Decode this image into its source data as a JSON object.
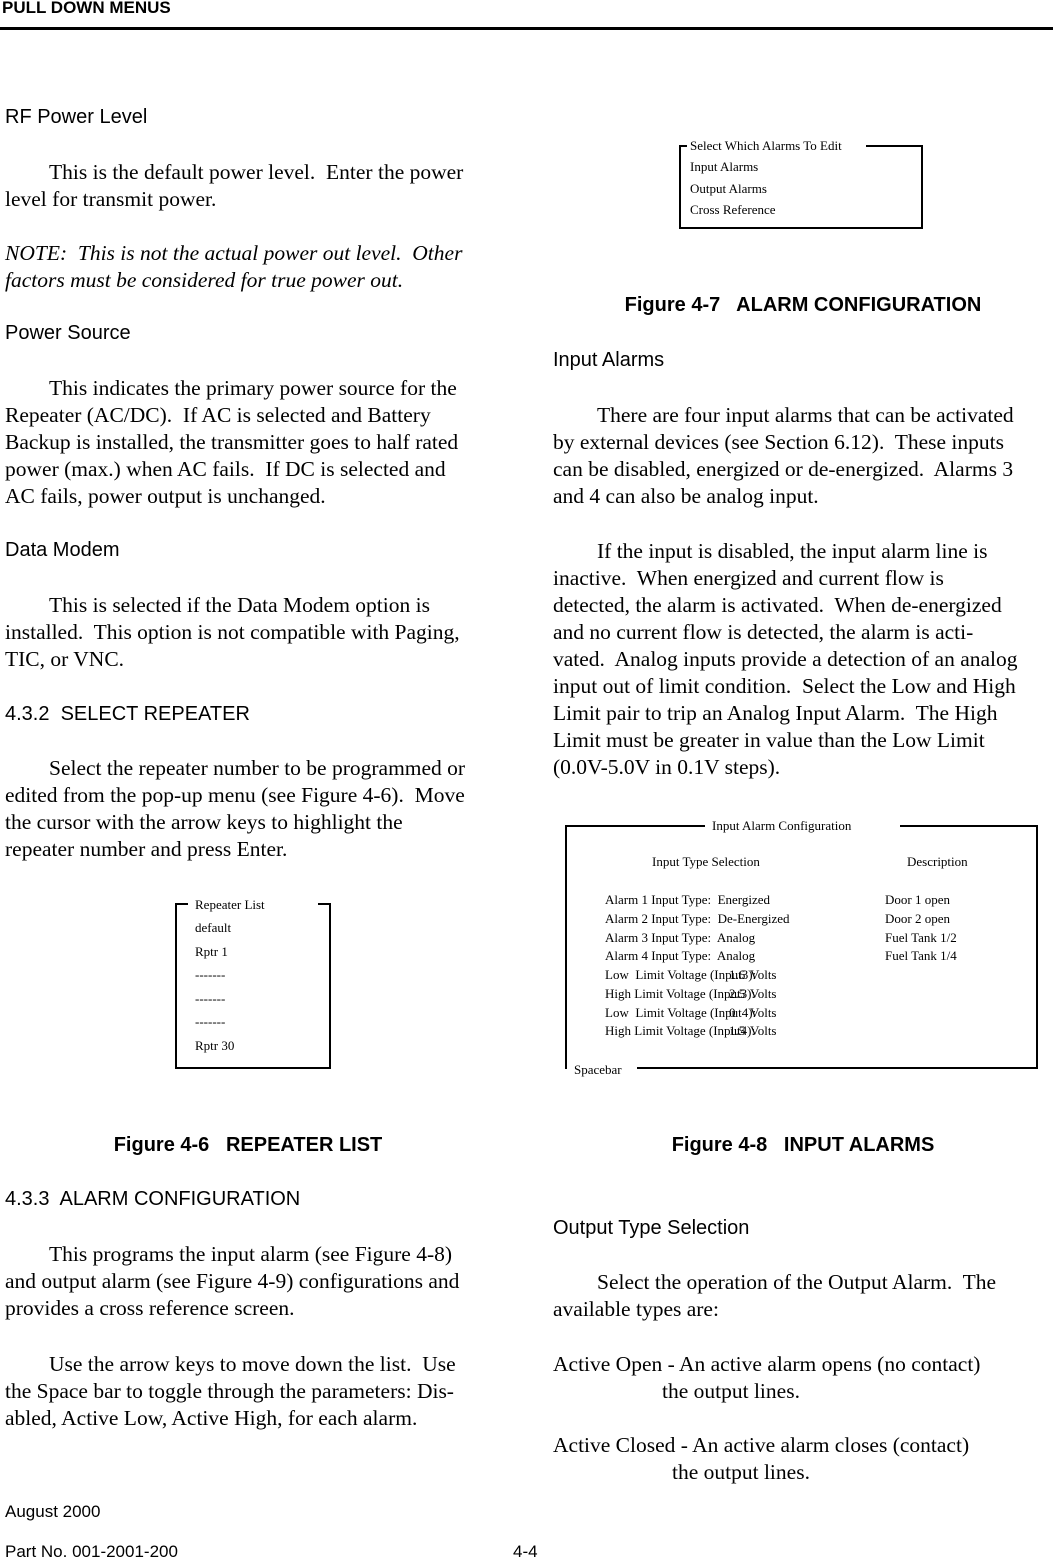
{
  "header": {
    "title": "PULL DOWN MENUS"
  },
  "left": {
    "rf_heading": "RF Power Level",
    "rf_para": [
      "This is the default power level.  Enter the power",
      "level for transmit power."
    ],
    "note": [
      "NOTE:  This is not the actual power out level.  Other",
      "factors must be considered for true power out."
    ],
    "power_heading": "Power Source",
    "power_para": [
      "This indicates the primary power source for the",
      "Repeater (AC/DC).  If AC is selected and Battery",
      "Backup is installed, the transmitter goes to half rated",
      "power (max.) when AC fails.  If DC is selected and",
      "AC fails, power output is unchanged."
    ],
    "modem_heading": "Data Modem",
    "modem_para": [
      "This is selected if the Data Modem option is",
      "installed.  This option is not compatible with Paging,",
      "TIC, or VNC."
    ],
    "select_heading": "4.3.2  SELECT REPEATER",
    "select_para": [
      "Select the repeater number to be programmed or",
      "edited from the pop-up menu (see Figure 4-6).  Move",
      "the cursor with the arrow keys to highlight the",
      "repeater number and press Enter."
    ],
    "fig6_caption": "Figure 4-6   REPEATER LIST",
    "alarm_heading": "4.3.3  ALARM CONFIGURATION",
    "alarm_para1": [
      "This programs the input alarm (see Figure 4-8)",
      "and output alarm (see Figure 4-9) configurations and",
      "provides a cross reference screen."
    ],
    "alarm_para2": [
      "Use the arrow keys to move down the list.  Use",
      "the Space bar to toggle through the parameters: Dis-",
      "abled, Active Low, Active High, for each alarm."
    ]
  },
  "repeater_list": {
    "title": "Repeater List",
    "items": [
      "default",
      "Rptr 1",
      "-------",
      "-------",
      "-------",
      "Rptr 30"
    ]
  },
  "alarm_select": {
    "title": "Select Which Alarms To Edit",
    "items": [
      "Input Alarms",
      "Output Alarms",
      "Cross Reference"
    ]
  },
  "right": {
    "fig7_caption": "Figure 4-7   ALARM CONFIGURATION",
    "input_heading": "Input Alarms",
    "input_para1": [
      "There are four input alarms that can be activated",
      "by external devices (see Section 6.12).  These inputs",
      "can be disabled, energized or de-energized.  Alarms 3",
      "and 4 can also be analog input."
    ],
    "input_para2": [
      "If the input is disabled, the input alarm line is",
      "inactive.  When energized and current flow is",
      "detected, the alarm is activated.  When de-energized",
      "and no current flow is detected, the alarm is acti-",
      "vated.  Analog inputs provide a detection of an analog",
      "input out of limit condition.  Select the Low and High",
      "Limit pair to trip an Analog Input Alarm.  The High",
      "Limit must be greater in value than the Low Limit",
      "(0.0V-5.0V in 0.1V steps)."
    ],
    "fig8_caption": "Figure 4-8   INPUT ALARMS",
    "output_heading": "Output Type Selection",
    "output_para": [
      "Select the operation of the Output Alarm.  The",
      "available types are:"
    ],
    "active_open": "Active Open - An active alarm opens (no contact)",
    "active_open_cont": "the output lines.",
    "active_closed": "Active Closed - An active alarm closes (contact)",
    "active_closed_cont": "the output lines."
  },
  "input_alarm_config": {
    "title": "Input Alarm Configuration",
    "col_selection": "Input Type Selection",
    "col_description": "Description",
    "alarms": [
      {
        "label": "Alarm 1 Input Type:  Energized",
        "description": "Door 1 open"
      },
      {
        "label": "Alarm 2 Input Type:  De-Energized",
        "description": "Door 2 open"
      },
      {
        "label": "Alarm 3 Input Type:  Analog",
        "description": "Fuel Tank 1/2"
      },
      {
        "label": "Alarm 4 Input Type:  Analog",
        "description": "Fuel Tank 1/4"
      }
    ],
    "limits": [
      {
        "label": "Low  Limit Voltage (Input3):",
        "value": "1.6",
        "unit": "Volts"
      },
      {
        "label": "High Limit Voltage (Input3):",
        "value": "2.5",
        "unit": "Volts"
      },
      {
        "label": "Low  Limit Voltage (Input4):",
        "value": "0",
        "unit": "Volts"
      },
      {
        "label": "High Limit Voltage (Input4):",
        "value": "1.5",
        "unit": "Volts"
      }
    ],
    "footer": "Spacebar"
  },
  "footer": {
    "date": "August 2000",
    "part_no": "Part No. 001-2001-200",
    "page": "4-4"
  }
}
